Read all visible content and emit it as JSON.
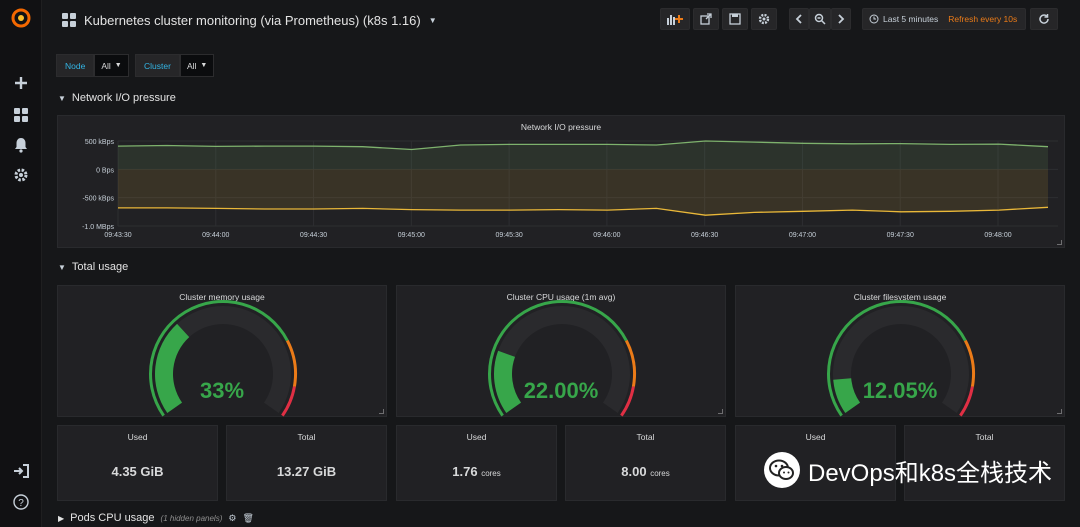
{
  "dashboard": {
    "title": "Kubernetes cluster monitoring (via Prometheus) (k8s 1.16)"
  },
  "toolbar": {
    "time_range": "Last 5 minutes",
    "refresh": "Refresh every 10s"
  },
  "variables": [
    {
      "label": "Node",
      "value": "All"
    },
    {
      "label": "Cluster",
      "value": "All"
    }
  ],
  "rows": {
    "network": "Network I/O pressure",
    "total": "Total usage",
    "pods": "Pods CPU usage",
    "pods_hidden": "(1 hidden panels)"
  },
  "chart_data": {
    "type": "area",
    "title": "Network I/O pressure",
    "x": [
      "09:43:30",
      "09:44:00",
      "09:44:30",
      "09:45:00",
      "09:45:30",
      "09:46:00",
      "09:46:30",
      "09:47:00",
      "09:47:30",
      "09:48:00"
    ],
    "yticks": [
      "500 kBps",
      "0 Bps",
      "-500 kBps",
      "-1.0 MBps"
    ],
    "ylim": [
      -1000,
      500
    ],
    "series": [
      {
        "color": "#7eb26d",
        "values": [
          410,
          420,
          405,
          410,
          410,
          400,
          350,
          430,
          440,
          440,
          440,
          430,
          500,
          480,
          460,
          450,
          455,
          440,
          445,
          400
        ]
      },
      {
        "color": "#eab839",
        "values": [
          -680,
          -680,
          -690,
          -700,
          -700,
          -690,
          -710,
          -720,
          -720,
          -710,
          -720,
          -690,
          -810,
          -760,
          -740,
          -720,
          -750,
          -740,
          -720,
          -670
        ]
      }
    ],
    "grid": true
  },
  "gauges": [
    {
      "title": "Cluster memory usage",
      "value_text": "33%",
      "value": 33
    },
    {
      "title": "Cluster CPU usage (1m avg)",
      "value_text": "22.00%",
      "value": 22
    },
    {
      "title": "Cluster filesystem usage",
      "value_text": "12.05%",
      "value": 12.05
    }
  ],
  "stats": [
    {
      "label": "Used",
      "value": "4.35 GiB",
      "unit": ""
    },
    {
      "label": "Total",
      "value": "13.27 GiB",
      "unit": ""
    },
    {
      "label": "Used",
      "value": "1.76",
      "unit": "cores"
    },
    {
      "label": "Total",
      "value": "8.00",
      "unit": "cores"
    },
    {
      "label": "Used",
      "value": "",
      "unit": ""
    },
    {
      "label": "Total",
      "value": "",
      "unit": ""
    }
  ],
  "watermark": "DevOps和k8s全栈技术",
  "colors": {
    "green": "#37a64a",
    "orange": "#eb7b18",
    "red": "#e02f44",
    "accent": "#33b5e5"
  }
}
